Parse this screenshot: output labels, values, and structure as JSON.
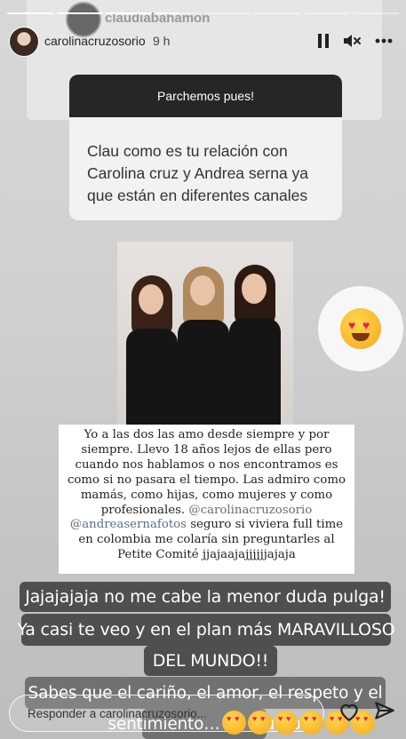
{
  "story": {
    "progress_segments": [
      1,
      1,
      1,
      0.5,
      0,
      0,
      0,
      0
    ],
    "background_username": "claudiabahamon"
  },
  "header": {
    "username": "carolinacruzosorio",
    "time": "9 h",
    "icons": [
      "pause-icon",
      "mute-icon",
      "more-icon"
    ]
  },
  "question": {
    "title": "Parchemos pues!",
    "text": "Clau como es tu relación con Carolina cruz y Andrea serna ya que están en diferentes canales"
  },
  "caption": {
    "text_start": "Yo a las dos las amo desde siempre y por siempre. Llevo 18 años lejos de ellas pero cuando nos hablamos o nos encontramos es como si no pasara el tiempo. Las admiro como mamás, como hijas, como mujeres y como profesionales. ",
    "mention_1": "@carolinacruzosorio",
    "mention_2": "@andreasernafotos",
    "text_end": " seguro si viviera full time en colombia me colaría sin preguntarles al Petite Comité jjajaajajjjjjjajaja"
  },
  "overlays": {
    "line1": "Jajajajaja no me cabe la menor duda pulga!",
    "line2": "Ya casi te veo y en el plan más MARAVILLOSO",
    "line3": "DEL MUNDO!!",
    "line4": "Sabes que el cariño, el amor, el respeto y el",
    "line5": "sentimiento… es mutuo"
  },
  "footer": {
    "reply_placeholder": "Responder a carolinacruzosorio...",
    "emoji_count": 6
  }
}
